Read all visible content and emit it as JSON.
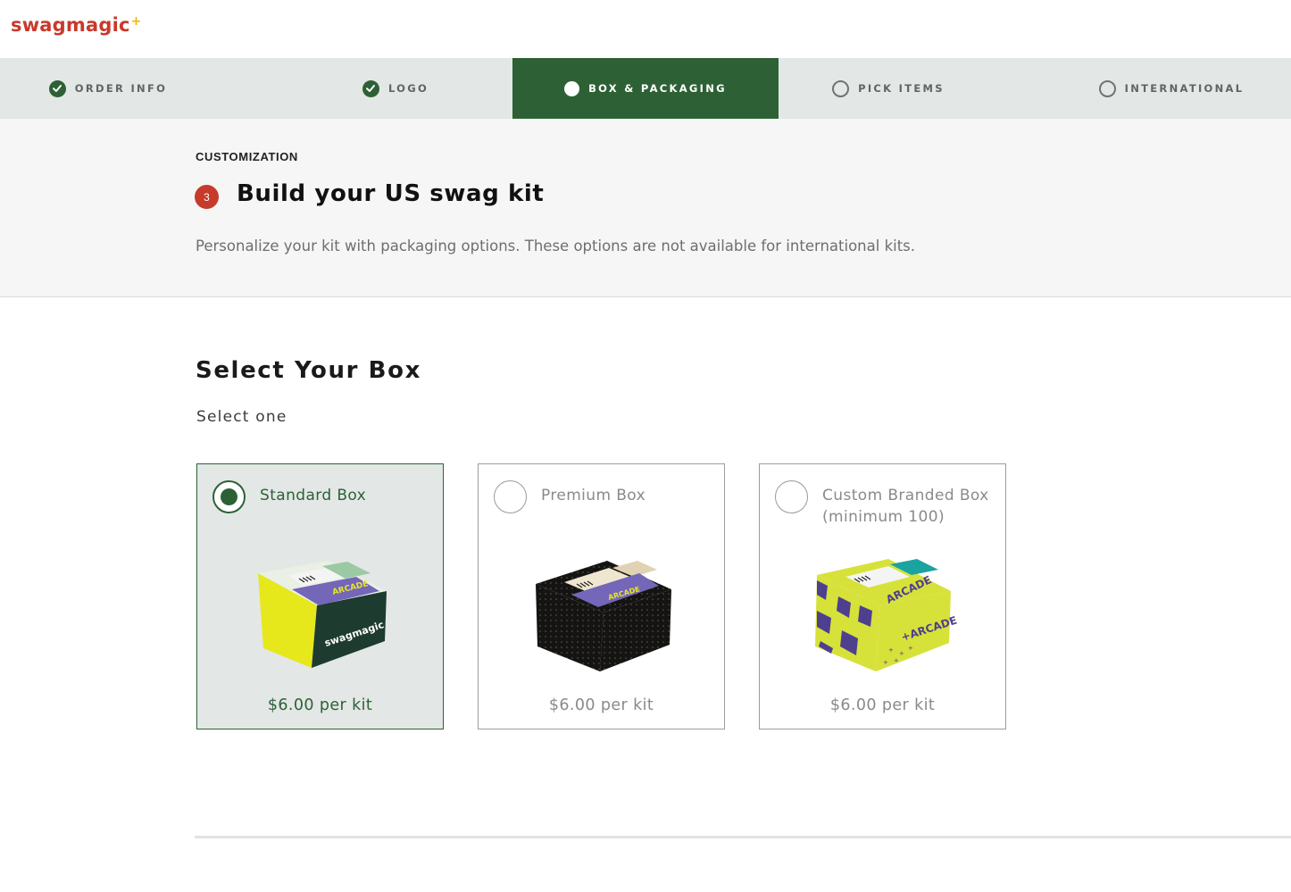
{
  "brand": {
    "name": "swagmagic",
    "spark": "+"
  },
  "steps": [
    {
      "label": "ORDER INFO",
      "state": "done"
    },
    {
      "label": "LOGO",
      "state": "done"
    },
    {
      "label": "BOX & PACKAGING",
      "state": "current"
    },
    {
      "label": "PICK ITEMS",
      "state": "todo"
    },
    {
      "label": "INTERNATIONAL",
      "state": "todo"
    }
  ],
  "header": {
    "eyebrow": "CUSTOMIZATION",
    "step_number": "3",
    "title": "Build your US swag kit",
    "subtitle": "Personalize your kit with packaging options. These options are not available for international kits."
  },
  "section": {
    "title": "Select Your Box",
    "hint": "Select one"
  },
  "options": [
    {
      "name": "Standard Box",
      "price": "$6.00 per kit",
      "selected": true,
      "box_label": "ARCADE",
      "box_brand": "swagmagic"
    },
    {
      "name": "Premium Box",
      "price": "$6.00 per kit",
      "selected": false,
      "box_label": "ARCADE"
    },
    {
      "name": "Custom Branded Box (minimum 100)",
      "price": "$6.00 per kit",
      "selected": false,
      "box_label": "ARCADE",
      "box_brand": "+ARCADE"
    }
  ],
  "colors": {
    "brand_green": "#2d6135",
    "brand_red": "#c63b2b",
    "stepper_bg": "#e3e7e6",
    "accent_purple": "#7466b8",
    "accent_lime": "#d6e23a"
  }
}
